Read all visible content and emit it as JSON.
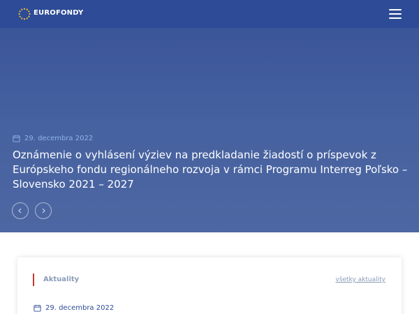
{
  "header": {
    "brand": "EUROFONDY",
    "logo_icon": "eu-stars-icon",
    "menu_icon": "hamburger-menu-icon"
  },
  "hero": {
    "date": "29. decembra 2022",
    "title": "Oznámenie o vyhlásení výziev na predkladanie žiadostí o príspevok z Európskeho fondu regionálneho rozvoja v rámci Programu Interreg Poľsko – Slovensko 2021 – 2027",
    "prev_icon": "chevron-left-icon",
    "next_icon": "chevron-right-icon"
  },
  "news": {
    "section_title": "Aktuality",
    "all_link": "všetky aktuality",
    "items": [
      {
        "date": "29. decembra 2022"
      }
    ]
  },
  "colors": {
    "header_bg": "#2d4b96",
    "hero_bg": "#46619f",
    "accent_red": "#c0392b",
    "date_text": "#8fb4ec",
    "muted_text": "#8a9bb8"
  }
}
